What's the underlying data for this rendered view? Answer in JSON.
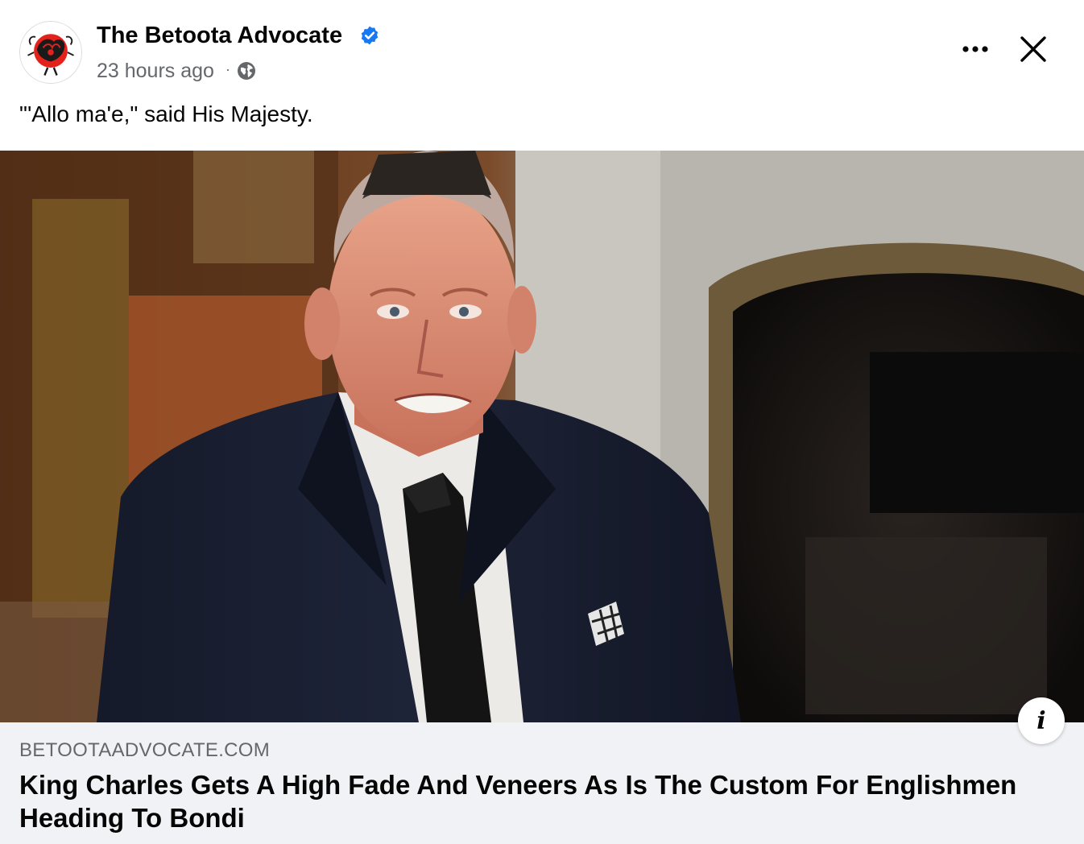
{
  "post": {
    "page_name": "The Betoota Advocate",
    "timestamp": "23 hours ago",
    "separator": "·",
    "privacy_icon": "globe-icon",
    "verified_icon": "verified-badge-icon",
    "more_icon": "more-options-icon",
    "close_icon": "close-icon",
    "caption": "\"'Allo ma'e,\" said His Majesty."
  },
  "link_preview": {
    "domain": "BETOOTAADVOCATE.COM",
    "headline": "King Charles Gets A High Fade And Veneers As Is The Custom For Englishmen Heading To Bondi",
    "info_label": "i",
    "info_icon": "info-icon"
  },
  "colors": {
    "verified_blue": "#1877f2",
    "secondary_text": "#65676b",
    "link_box_bg": "#f0f2f5",
    "logo_red": "#e4221c"
  }
}
